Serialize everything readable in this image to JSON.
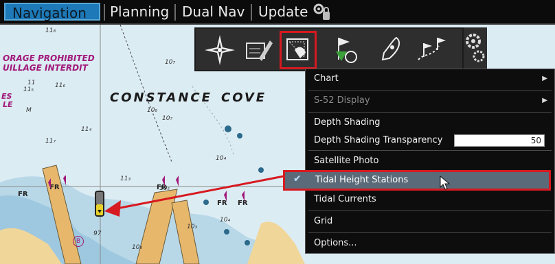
{
  "tabs": [
    {
      "label": "Navigation",
      "active": true
    },
    {
      "label": "Planning",
      "active": false
    },
    {
      "label": "Dual Nav",
      "active": false
    },
    {
      "label": "Update",
      "active": false
    }
  ],
  "chart": {
    "anchorage_line1": "ORAGE PROHIBITED",
    "anchorage_line2": "UILLAGE INTERDIT",
    "place_word1": "CONSTANCE",
    "place_word2": "COVE",
    "side_es": "ES",
    "side_e": "LE",
    "fr_label": "FR",
    "marker_b": "B",
    "depths": [
      "11₈",
      "11₅",
      "10₇",
      "11",
      "11₆",
      "11₄",
      "M",
      "11₇",
      "10₈",
      "11₃",
      "10₅",
      "10₇",
      "10₃",
      "10₉",
      "10₄",
      "10₄",
      "97"
    ]
  },
  "toolbar": {
    "tools": [
      "compass-rose-icon",
      "route-pencil-icon",
      "chart-overlays-icon",
      "waypoint-flag-icon",
      "vessel-icon",
      "routes-flags-icon"
    ]
  },
  "menu": {
    "items": [
      {
        "label": "Chart",
        "submenu": true,
        "dim": false
      },
      {
        "label": "S-52 Display",
        "submenu": true,
        "dim": true
      },
      {
        "label": "Depth Shading",
        "submenu": false,
        "dim": false
      },
      {
        "label": "Depth Shading Transparency",
        "submenu": false,
        "dim": false
      },
      {
        "label": "Satellite Photo",
        "submenu": false,
        "dim": false
      },
      {
        "label": "Tidal Height Stations",
        "submenu": false,
        "dim": false,
        "checked": true
      },
      {
        "label": "Tidal Currents",
        "submenu": false,
        "dim": false
      },
      {
        "label": "Grid",
        "submenu": false,
        "dim": false
      },
      {
        "label": "Options...",
        "submenu": false,
        "dim": false
      }
    ],
    "transparency_value": "50",
    "check_mark": "✔"
  },
  "colors": {
    "accent_tab": "#1d79b8",
    "highlight": "#d71920",
    "menu_bg": "#0d0d0d",
    "selected_row": "#5b6a78"
  }
}
